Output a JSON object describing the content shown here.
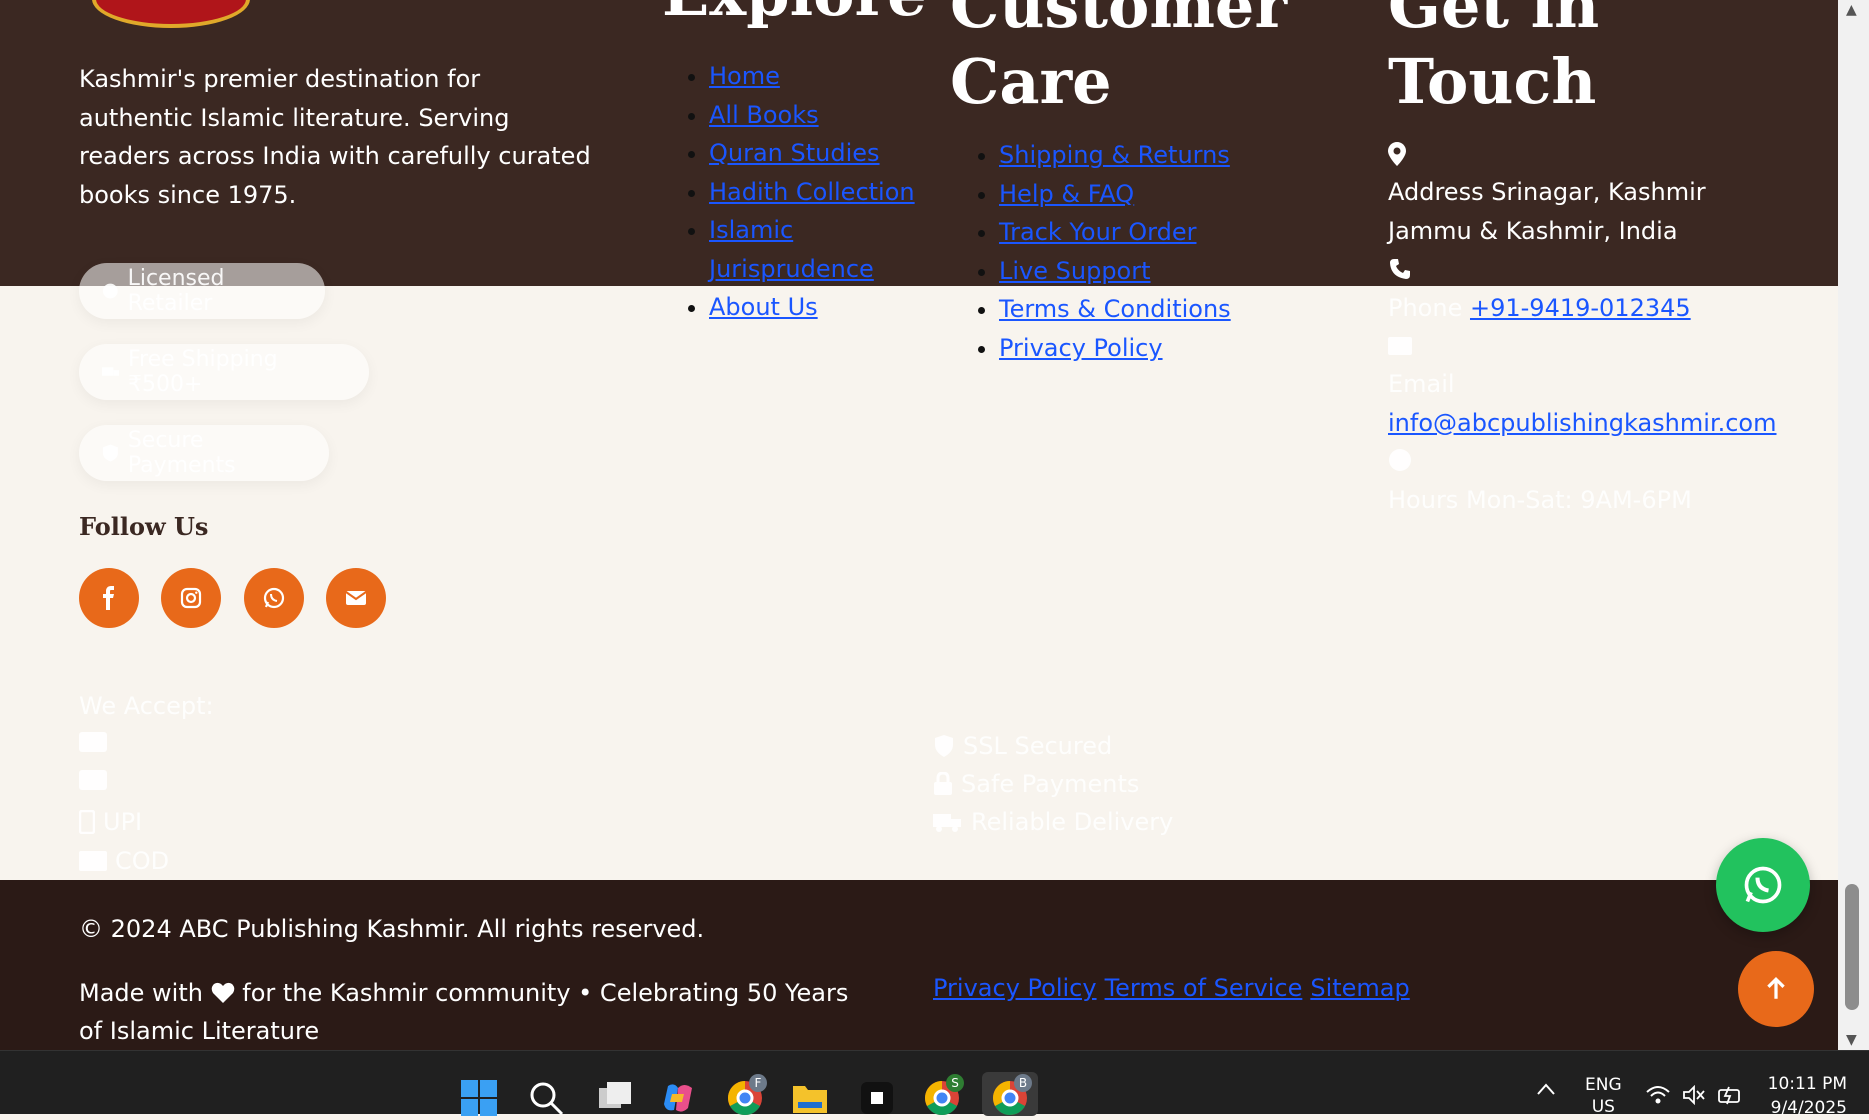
{
  "about": {
    "text": "Kashmir's premier destination for authentic Islamic literature. Serving readers across India with carefully curated books since 1975.",
    "badges": [
      {
        "label": "Licensed Retailer",
        "icon": "certificate-icon"
      },
      {
        "label": "Free Shipping ₹500+",
        "icon": "truck-icon"
      },
      {
        "label": "Secure Payments",
        "icon": "shield-icon"
      }
    ]
  },
  "follow": {
    "title": "Follow Us",
    "icons": [
      "facebook-icon",
      "instagram-icon",
      "whatsapp-icon",
      "envelope-icon"
    ]
  },
  "explore": {
    "heading": "Explore",
    "links": [
      {
        "label": "Home"
      },
      {
        "label": "All Books"
      },
      {
        "label": "Quran Studies"
      },
      {
        "label": "Hadith Collection"
      },
      {
        "label": "Islamic Jurisprudence"
      },
      {
        "label": "About Us"
      }
    ]
  },
  "care": {
    "heading": "Customer Care",
    "links": [
      {
        "label": "Shipping & Returns"
      },
      {
        "label": "Help & FAQ"
      },
      {
        "label": "Track Your Order"
      },
      {
        "label": "Live Support"
      },
      {
        "label": "Terms & Conditions"
      },
      {
        "label": "Privacy Policy"
      }
    ]
  },
  "contact": {
    "heading": "Get in Touch",
    "address": "Address Srinagar, Kashmir Jammu & Kashmir, India",
    "phone_label": "Phone",
    "phone": "+91-9419-012345",
    "email_label": "Email",
    "email": "info@abcpublishingkashmir.com",
    "hours": "Hours Mon-Sat: 9AM-6PM"
  },
  "payments": {
    "title": "We Accept:",
    "methods": [
      "",
      "",
      "UPI",
      "COD"
    ],
    "trust": [
      "SSL Secured",
      "Safe Payments",
      "Reliable Delivery"
    ]
  },
  "bottom": {
    "copyright": "© 2024 ABC Publishing Kashmir. All rights reserved.",
    "made_with_1": "Made with",
    "made_with_2": "for the Kashmir community • Celebrating 50 Years of Islamic Literature",
    "links": [
      "Privacy Policy",
      "Terms of Service",
      "Sitemap"
    ]
  },
  "taskbar": {
    "lang_1": "ENG",
    "lang_2": "US",
    "time": "10:11 PM",
    "date": "9/4/2025",
    "badges": {
      "chrome1": "F",
      "chrome2": "S",
      "chrome3": "B"
    }
  },
  "colors": {
    "top_bg": "#3b2822",
    "bottom_bg": "#2b1a16",
    "accent": "#e8691a",
    "link": "#1a56ff",
    "whatsapp": "#22c25e"
  }
}
